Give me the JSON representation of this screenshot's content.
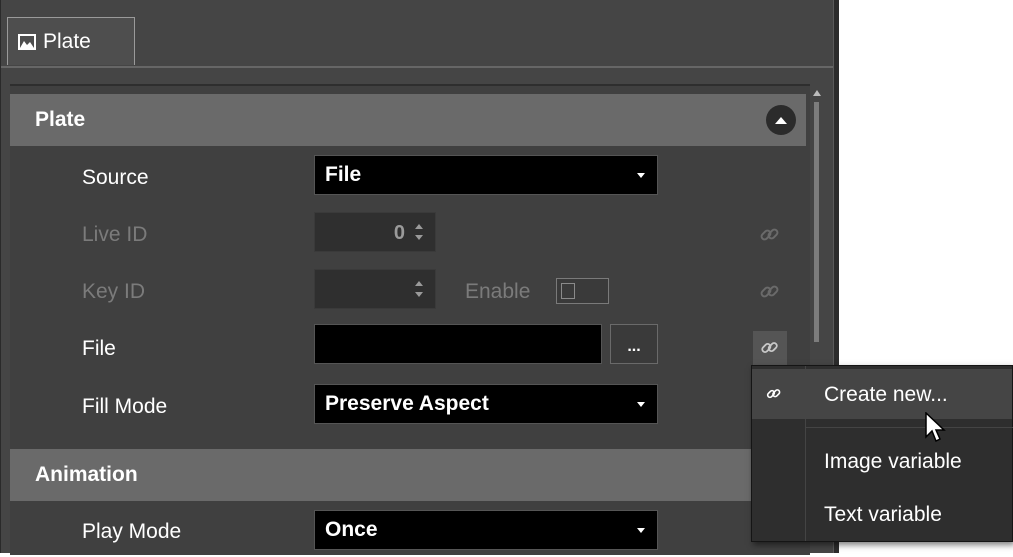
{
  "tab": {
    "label": "Plate",
    "icon": "image-icon"
  },
  "sections": [
    {
      "title": "Plate",
      "rows": {
        "source": {
          "label": "Source",
          "value": "File"
        },
        "live_id": {
          "label": "Live ID",
          "value": "0"
        },
        "key_id": {
          "label": "Key ID",
          "value": "",
          "enable_label": "Enable"
        },
        "file": {
          "label": "File",
          "value": "",
          "browse_label": "..."
        },
        "fill_mode": {
          "label": "Fill Mode",
          "value": "Preserve Aspect"
        }
      }
    },
    {
      "title": "Animation",
      "rows": {
        "play_mode": {
          "label": "Play Mode",
          "value": "Once"
        }
      }
    }
  ],
  "context_menu": {
    "items": [
      {
        "label": "Create new...",
        "icon": "link-icon",
        "highlighted": true
      },
      {
        "label": "Image variable"
      },
      {
        "label": "Text variable"
      }
    ]
  },
  "colors": {
    "panel_bg": "#454545",
    "section_header_bg": "#6a6a6a",
    "field_bg": "#000000",
    "menu_bg": "#2e2e2e"
  }
}
